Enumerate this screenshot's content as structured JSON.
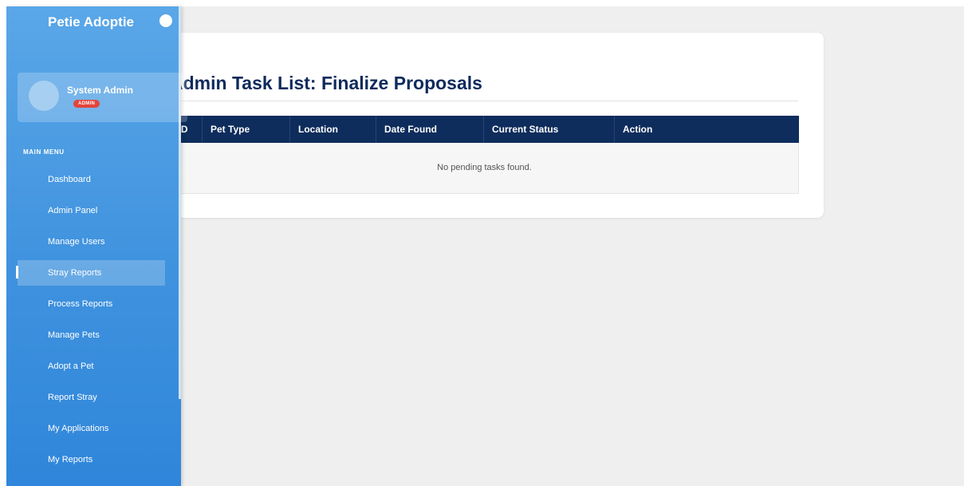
{
  "sidebar": {
    "brand": "Petie Adoptie",
    "profile": {
      "name": "System Admin",
      "role": "ADMIN"
    },
    "section_label": "MAIN MENU",
    "items": [
      {
        "label": "Dashboard"
      },
      {
        "label": "Admin Panel"
      },
      {
        "label": "Manage Users"
      },
      {
        "label": "Stray Reports"
      },
      {
        "label": "Process Reports"
      },
      {
        "label": "Manage Pets"
      },
      {
        "label": "Adopt a Pet"
      },
      {
        "label": "Report Stray"
      },
      {
        "label": "My Applications"
      },
      {
        "label": "My Reports"
      }
    ],
    "active_item": "Stray Reports"
  },
  "main": {
    "title": "Admin Task List: Finalize Proposals",
    "table": {
      "columns": [
        "ID",
        "Pet Type",
        "Location",
        "Date Found",
        "Current Status",
        "Action"
      ],
      "empty_message": "No pending tasks found."
    }
  },
  "colors": {
    "sidebar_top": "#5aa7e8",
    "sidebar_bottom": "#2f86da",
    "header_navy": "#0e2d5c",
    "title_navy": "#0e2a5c",
    "badge_red": "#e2453c",
    "page_bg": "#efefef"
  }
}
